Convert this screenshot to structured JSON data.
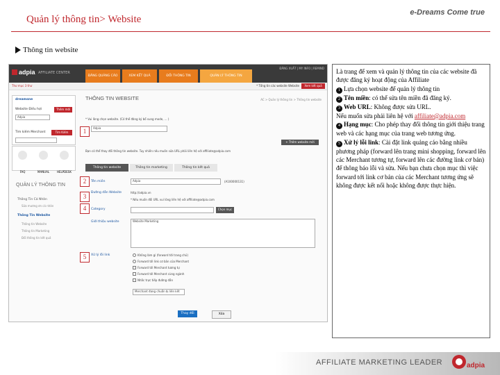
{
  "slide": {
    "title": "Quản lý thông tin> Website",
    "brand": "e-Dreams Come true",
    "section": "Thông tin website"
  },
  "screenshot": {
    "logo": "adpia",
    "nav_label": "AFFILIATE CENTER",
    "nav_tabs": [
      "ĐĂNG QUẢNG CÁO",
      "XEM KẾT QUẢ",
      "ĐỐI THÔNG TIN",
      "QUẢN LÝ THÔNG TIN"
    ],
    "top_links": "ĐĂNG XUẤT  |  MY INFO  |  REMIND",
    "sub_left": "Thư mục 3 thư",
    "sub_right": "* Tổng tin các website",
    "sub_select": "Website",
    "sub_button": "Xem kết quả",
    "username": "dreamsne",
    "site_select_label": "Website Điều hợi",
    "site_select_value": "Adpia",
    "manage_btn": "Thêm mới",
    "merchant_label": "Tìm kiếm Merchant",
    "merchant_btn": "Tìm Kiếm",
    "icons": [
      "FAQ",
      "MANUAL",
      "HELPDESK"
    ],
    "left_title": "QUẢN LÝ THÔNG TIN",
    "left_nav": [
      {
        "label": "Thông Tin Cá Nhân",
        "sub": "Sửa mương ơn cá nhân"
      },
      {
        "label": "Thông Tin Website",
        "sub": ""
      }
    ],
    "left_sub_items": [
      "Thông tin Website",
      "Thông tin Marketing",
      "Đổi thông tin kết quả"
    ],
    "main_title": "THÔNG TIN WEBSITE",
    "breadcrumb": "AC > Quản lý thông tin > Thông tin website",
    "notice": "* Vui lòng chọn website. (Có thể đăng ký bổ sung mode, ... )",
    "select_value": "Adpia",
    "add_btn": "+ Thêm website mới",
    "instruction": "Bạn có thể thay đổi thông tin website. Tuy nhiên nếu muốn sửa URL phải liên hệ với affiliate@adpia.com",
    "tabs": [
      "Thông tin website",
      "Thông tin marketing",
      "Thông tin kết quả"
    ],
    "rows": [
      {
        "label": "Tên miền",
        "value": "Adpia",
        "extra": "(A100000131)"
      },
      {
        "label": "Đường dẫn Website",
        "value": "http://adpia.vn",
        "extra": ""
      },
      {
        "label": "Category",
        "value": "",
        "extra": "Chọn mục"
      },
      {
        "label": "Giới thiệu website",
        "value": "Website Marketing",
        "extra": ""
      }
    ],
    "url_note": "* Nếu muốn đổi URL vui lòng liên hệ với affiliate@adpia.com",
    "link_label": "Xử lý lỗi link",
    "link_options": [
      "Không làm gì (forward tới trang chủ)",
      "Forward tới link cơ bản của Merchant",
      "Forward tới Merchant tương tự",
      "Forward tới Merchant cùng ngành",
      "Nhắc trực tiếp đường dẫn",
      "Merchant đang chuẩn bị liên kết"
    ],
    "save_label": "Thay đổi",
    "delete_label": "Xóa"
  },
  "markers": [
    "1",
    "2",
    "3",
    "4",
    "5"
  ],
  "description": {
    "intro": "Là trang để xem và quản lý thông tin của các website đã được đăng ký hoạt động của Affiliate",
    "item1": "Lựa chọn website để quản lý thông tin",
    "item2_bold": "Tên miền",
    "item2_rest": ": có thể sửa tên miền đã đăng ký.",
    "item3_bold": "Web URL",
    "item3_rest": ": Không được sửa URL.",
    "item3_note": "Nếu muốn sửa phải liên hệ với",
    "item3_link": "affiliate@adpia.com",
    "item4_bold": "Hạng mục",
    "item4_rest": ": Cho phép thay đổi thông tin giới thiệu trang web và các hạng mục của trang web tương ứng.",
    "item5_bold": "Xử lý lỗi link",
    "item5_rest": ": Cài đặt link quảng cáo bằng nhiều phương pháp (forward lên trang mini shopping, forward lên các Merchant tương tự, forward lên các đường link cơ bản) để thông báo lỗi và sửa. Nếu bạn chưa chọn mục thì việc forward tới link cơ bản của các Merchant tương ứng sẽ không được kết nối hoặc không được thực hiện."
  },
  "footer": {
    "text": "AFFILIATE MARKETING LEADER",
    "logo": "adpia"
  },
  "colors": {
    "accent": "#c0272d",
    "nav": "#e87c1d",
    "link": "#1a55a0"
  }
}
